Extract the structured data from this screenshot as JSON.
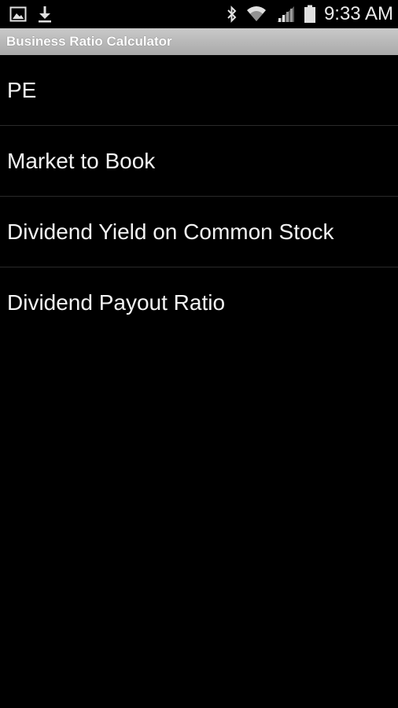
{
  "status_bar": {
    "time": "9:33 AM",
    "left_icons": [
      "gallery-icon",
      "download-icon"
    ],
    "right_icons": [
      "bluetooth-icon",
      "wifi-icon",
      "signal-icon",
      "battery-icon"
    ]
  },
  "title_bar": {
    "title": "Business Ratio Calculator"
  },
  "menu": {
    "items": [
      {
        "label": "PE"
      },
      {
        "label": "Market to Book"
      },
      {
        "label": "Dividend Yield on Common Stock"
      },
      {
        "label": "Dividend Payout Ratio"
      }
    ]
  },
  "colors": {
    "background": "#000000",
    "title_bar": "#b5b5b5",
    "text": "#f2f2f2",
    "divider": "#2a2a2a"
  }
}
